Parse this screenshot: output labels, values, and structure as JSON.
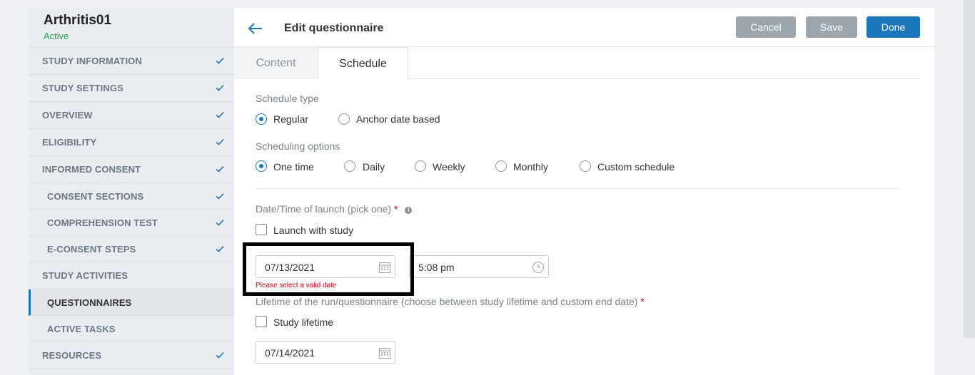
{
  "study": {
    "name": "Arthritis01",
    "status": "Active"
  },
  "sidebar": {
    "items": [
      {
        "label": "STUDY INFORMATION",
        "checked": true
      },
      {
        "label": "STUDY SETTINGS",
        "checked": true
      },
      {
        "label": "OVERVIEW",
        "checked": true
      },
      {
        "label": "ELIGIBILITY",
        "checked": true
      },
      {
        "label": "INFORMED CONSENT",
        "checked": true
      },
      {
        "label": "CONSENT SECTIONS",
        "checked": true
      },
      {
        "label": "COMPREHENSION TEST",
        "checked": true
      },
      {
        "label": "E-CONSENT STEPS",
        "checked": true
      },
      {
        "label": "STUDY ACTIVITIES",
        "checked": false
      },
      {
        "label": "QUESTIONNAIRES",
        "checked": false,
        "active": true
      },
      {
        "label": "ACTIVE TASKS",
        "checked": false
      },
      {
        "label": "RESOURCES",
        "checked": true
      }
    ]
  },
  "header": {
    "title": "Edit questionnaire",
    "cancel_label": "Cancel",
    "save_label": "Save",
    "done_label": "Done"
  },
  "tabs": {
    "content": "Content",
    "schedule": "Schedule",
    "active": "Schedule"
  },
  "schedule": {
    "type_label": "Schedule type",
    "type_options": [
      "Regular",
      "Anchor date based"
    ],
    "type_selected": "Regular",
    "options_label": "Scheduling options",
    "options": [
      "One time",
      "Daily",
      "Weekly",
      "Monthly",
      "Custom schedule"
    ],
    "option_selected": "One time",
    "launch_label": "Date/Time of launch (pick one)",
    "launch_required": "*",
    "launch_with_study": "Launch with study",
    "launch_date": "07/13/2021",
    "launch_time": "5:08 pm",
    "launch_error": "Please select a valid date",
    "lifetime_label": "Lifetime of the run/questionnaire (choose between study lifetime and custom end date)",
    "lifetime_required": "*",
    "study_lifetime": "Study lifetime",
    "end_date": "07/14/2021"
  },
  "colors": {
    "primary": "#1b75bb",
    "muted_button": "#9da5ad",
    "error": "#d0021b",
    "success": "#2e9b4a"
  }
}
